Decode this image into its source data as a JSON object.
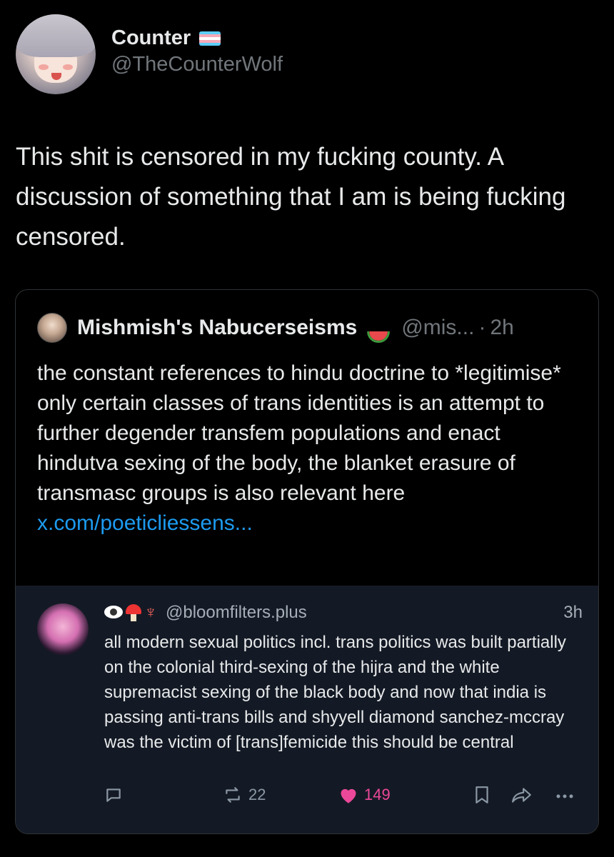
{
  "author": {
    "display_name": "Counter",
    "handle": "@TheCounterWolf"
  },
  "tweet": {
    "text": "This shit is censored in my fucking county. A discussion of something that I am is being fucking censored."
  },
  "quote": {
    "display_name": "Mishmish's Nabucerseisms",
    "handle": "@mis...",
    "separator": "·",
    "time": "2h",
    "body": "the constant references to hindu doctrine to *legitimise* only certain classes of trans identities is an attempt to further degender transfem populations and enact hindutva sexing of the body, the blanket erasure of transmasc groups is also relevant here",
    "link": "x.com/poeticliessens..."
  },
  "nested": {
    "handle": "@bloomfilters.plus",
    "time": "3h",
    "body": "all modern sexual politics incl. trans politics was built partially on the colonial third-sexing of the hijra and the white supremacist sexing of the black body and now that india is passing anti-trans bills and shyyell diamond sanchez-mccray was the victim of [trans]femicide this should be central"
  },
  "actions": {
    "repost_count": "22",
    "like_count": "149",
    "like_color": "#ec4899"
  }
}
